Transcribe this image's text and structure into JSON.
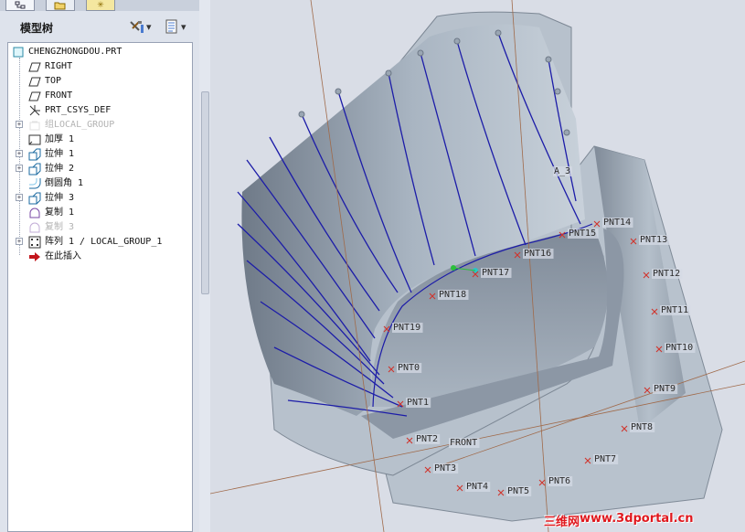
{
  "tabs": [
    {
      "icon": "model-tree-icon"
    },
    {
      "icon": "folder-icon"
    },
    {
      "icon": "favorites-star-icon"
    }
  ],
  "panel": {
    "title": "模型树",
    "tools": [
      {
        "icon": "settings-tools-icon",
        "arrow": "▾"
      },
      {
        "icon": "tree-columns-icon",
        "arrow": "▾"
      }
    ]
  },
  "tree": [
    {
      "label": "CHENGZHONGDOU.PRT",
      "icon": "part-icon",
      "expander": false,
      "dim": false,
      "level": 0
    },
    {
      "label": "RIGHT",
      "icon": "datum-plane-icon",
      "expander": false,
      "dim": false,
      "level": 1
    },
    {
      "label": "TOP",
      "icon": "datum-plane-icon",
      "expander": false,
      "dim": false,
      "level": 1
    },
    {
      "label": "FRONT",
      "icon": "datum-plane-icon",
      "expander": false,
      "dim": false,
      "level": 1
    },
    {
      "label": "PRT_CSYS_DEF",
      "icon": "coordinate-system-icon",
      "expander": false,
      "dim": false,
      "level": 1
    },
    {
      "label": "组LOCAL_GROUP",
      "icon": "group-icon",
      "expander": true,
      "dim": true,
      "level": 1
    },
    {
      "label": "加厚 1",
      "icon": "thicken-icon",
      "expander": false,
      "dim": false,
      "level": 1
    },
    {
      "label": "拉伸 1",
      "icon": "extrude-icon",
      "expander": true,
      "dim": false,
      "level": 1
    },
    {
      "label": "拉伸 2",
      "icon": "extrude-icon",
      "expander": true,
      "dim": false,
      "level": 1
    },
    {
      "label": "倒圆角 1",
      "icon": "round-icon",
      "expander": false,
      "dim": false,
      "level": 1
    },
    {
      "label": "拉伸 3",
      "icon": "extrude-icon",
      "expander": true,
      "dim": false,
      "level": 1
    },
    {
      "label": "复制 1",
      "icon": "copy-icon",
      "expander": false,
      "dim": false,
      "level": 1
    },
    {
      "label": "复制 3",
      "icon": "copy-icon",
      "expander": false,
      "dim": true,
      "level": 1
    },
    {
      "label": "阵列 1 / LOCAL_GROUP_1",
      "icon": "pattern-icon",
      "expander": true,
      "dim": false,
      "level": 1
    },
    {
      "label": "在此插入",
      "icon": "insert-here-arrow-icon",
      "expander": false,
      "dim": false,
      "level": 1
    }
  ],
  "viewport": {
    "points": [
      "A_3",
      "PNT14",
      "PNT15",
      "PNT13",
      "PNT16",
      "PNT17",
      "PNT12",
      "PNT18",
      "PNT11",
      "PNT19",
      "PNT10",
      "PNT0",
      "PNT9",
      "PNT1",
      "PNT8",
      "PNT2",
      "FRONT",
      "PNT7",
      "PNT3",
      "PNT6",
      "PNT4",
      "PNT5"
    ]
  },
  "colors": {
    "model": "#a9b6c3",
    "model_dark": "#7d8896",
    "curve": "#1c1ca8",
    "point_marker": "#d0342c",
    "label_bg": "#d4dae4"
  },
  "watermark": {
    "parts": [
      "三维网",
      "www.3dportal.cn"
    ]
  }
}
